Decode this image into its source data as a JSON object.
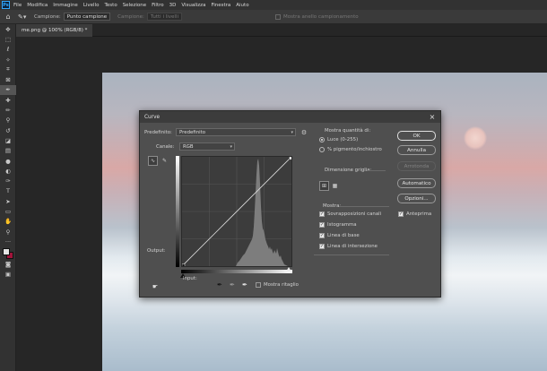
{
  "menubar": {
    "items": [
      "File",
      "Modifica",
      "Immagine",
      "Livello",
      "Testo",
      "Selezione",
      "Filtro",
      "3D",
      "Visualizza",
      "Finestra",
      "Aiuto"
    ]
  },
  "options": {
    "sample_label": "Campione:",
    "sample_value": "Punto campione",
    "sample_size_label": "Campione:",
    "sample_size_value": "Tutti i livelli",
    "show_ring": "Mostra anello campionamento"
  },
  "document_tab": "me.png @ 100% (RGB/8) *",
  "colors": {
    "foreground": "#e5e5e5",
    "background": "#a0143a",
    "ps_blue": "#31a8ff"
  },
  "dialog": {
    "title": "Curve",
    "close": "×",
    "preset_label": "Predefinito:",
    "preset_value": "Predefinito",
    "channel_label": "Canale:",
    "channel_value": "RGB",
    "output_label": "Output:",
    "input_label": "Input:",
    "show_clipping": "Mostra ritaglio",
    "show_amount_title": "Mostra quantità di:",
    "light_option": "Luce (0-255)",
    "pigment_option": "% pigmento/inchiostro",
    "grid_title": "Dimensione griglia:",
    "show_title": "Mostra:",
    "channel_overlays": "Sovrapposizioni canali",
    "histogram": "Istogramma",
    "baseline": "Linea di base",
    "intersection_line": "Linea di intersezione",
    "preview": "Anteprima",
    "buttons": {
      "ok": "OK",
      "cancel": "Annulla",
      "smooth": "Arrotonda",
      "auto": "Automatico",
      "options": "Opzioni..."
    },
    "icons": {
      "settings": "gear-icon",
      "curve_tool": "curve-point-icon",
      "pencil": "pencil-icon",
      "hand": "on-image-adjust-icon",
      "eyedropper": "eyedropper-icon"
    }
  }
}
